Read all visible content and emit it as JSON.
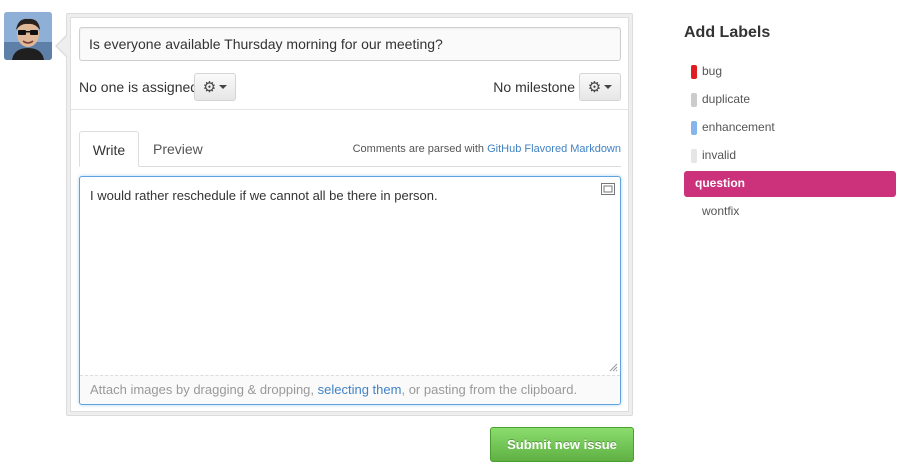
{
  "issue": {
    "title_value": "Is everyone available Thursday morning for our meeting?",
    "assignee_text": "No one is assigned",
    "milestone_text": "No milestone",
    "body_value": "I would rather reschedule if we cannot all be there in person.",
    "attach_prefix": "Attach images by dragging & dropping, ",
    "attach_link": "selecting them",
    "attach_suffix": ", or pasting from the clipboard.",
    "submit_label": "Submit new issue"
  },
  "tabs": [
    {
      "label": "Write",
      "active": true
    },
    {
      "label": "Preview",
      "active": false
    }
  ],
  "markdown_note": {
    "prefix": "Comments are parsed with ",
    "link": "GitHub Flavored Markdown"
  },
  "labels": {
    "heading": "Add Labels",
    "items": [
      {
        "name": "bug",
        "color": "#e11d21",
        "selected": false
      },
      {
        "name": "duplicate",
        "color": "#cccccc",
        "selected": false
      },
      {
        "name": "enhancement",
        "color": "#84b6eb",
        "selected": false
      },
      {
        "name": "invalid",
        "color": "#e6e6e6",
        "selected": false
      },
      {
        "name": "question",
        "color": "#cc317c",
        "selected": true
      },
      {
        "name": "wontfix",
        "color": "#ffffff",
        "selected": false
      }
    ]
  },
  "icons": {
    "assignee_gear": "gear-icon",
    "milestone_gear": "gear-icon",
    "fullscreen": "fullscreen-icon",
    "avatar": "user-avatar"
  },
  "colors": {
    "submit_green": "#60b044",
    "link_blue": "#4183c4",
    "focus_blue": "#5fa2dd"
  }
}
